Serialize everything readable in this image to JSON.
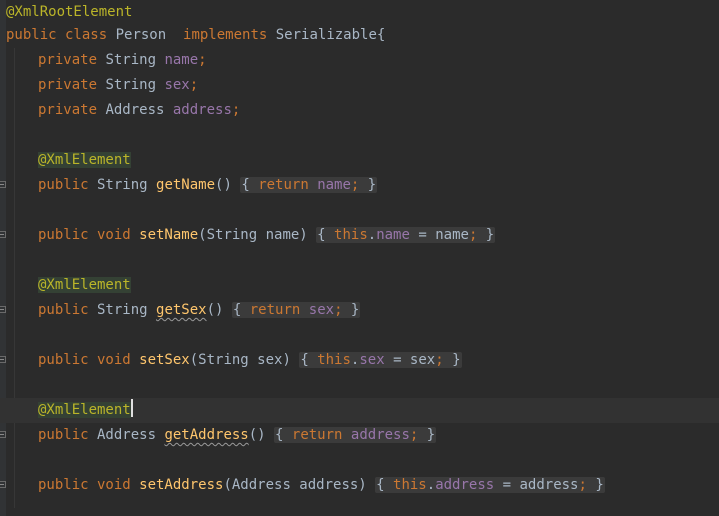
{
  "editor": {
    "lines": {
      "l1": {
        "ann": "@XmlRootElement"
      },
      "l2": {
        "kw1": "public class",
        "name": " Person  ",
        "kw2": "implements",
        "iface": " Serializable{"
      },
      "l3": {
        "kw": "private",
        "type": " String ",
        "field": "name",
        "semi": ";"
      },
      "l4": {
        "kw": "private",
        "type": " String ",
        "field": "sex",
        "semi": ";"
      },
      "l5": {
        "kw": "private",
        "type": " Address ",
        "field": "address",
        "semi": ";"
      },
      "l7": {
        "ann": "@XmlElement"
      },
      "l8": {
        "kw": "public",
        "type": " String ",
        "fn": "getName",
        "parens": "() ",
        "ob": "{",
        "ret": " return ",
        "field": "name",
        "semi": ";",
        "cb": " }"
      },
      "l10": {
        "kw": "public void",
        "fn": " setName",
        "params": "(String name) ",
        "ob": "{",
        "this": " this",
        "dot": ".",
        "field": "name",
        "rest": " = name",
        "semi": ";",
        "cb": " }"
      },
      "l12": {
        "ann": "@XmlElement"
      },
      "l13": {
        "kw": "public",
        "type": " String ",
        "fn": "getSex",
        "parens": "() ",
        "ob": "{",
        "ret": " return ",
        "field": "sex",
        "semi": ";",
        "cb": " }"
      },
      "l15": {
        "kw": "public void",
        "fn": " setSex",
        "params": "(String sex) ",
        "ob": "{",
        "this": " this",
        "dot": ".",
        "field": "sex",
        "rest": " = sex",
        "semi": ";",
        "cb": " }"
      },
      "l17": {
        "ann": "@XmlElement"
      },
      "l18": {
        "kw": "public",
        "type": " Address ",
        "fn": "getAddress",
        "parens": "() ",
        "ob": "{",
        "ret": " return ",
        "field": "address",
        "semi": ";",
        "cb": " }"
      },
      "l20": {
        "kw": "public void",
        "fn": " setAddress",
        "params": "(Address address) ",
        "ob": "{",
        "this": " this",
        "dot": ".",
        "field": "address",
        "rest": " = address",
        "semi": ";",
        "cb": " }"
      }
    }
  },
  "colors": {
    "background": "#2b2b2b",
    "keyword": "#cc7832",
    "annotation": "#bbb529",
    "field": "#9876aa",
    "method": "#ffc66d",
    "text": "#a9b7c6"
  }
}
